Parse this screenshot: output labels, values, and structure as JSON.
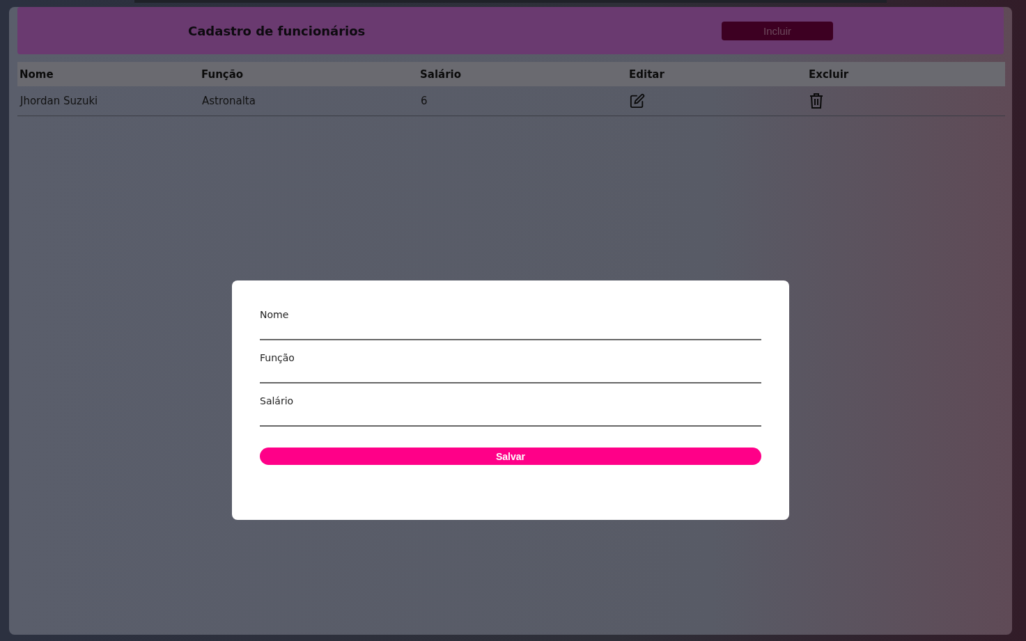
{
  "header": {
    "title": "Cadastro de funcionários",
    "button": "Incluir"
  },
  "table": {
    "columns": [
      "Nome",
      "Função",
      "Salário",
      "Editar",
      "Excluir"
    ],
    "rows": [
      {
        "nome": "Jhordan Suzuki",
        "funcao": "Astronalta",
        "salario": "6"
      }
    ]
  },
  "modal": {
    "fields": [
      {
        "label": "Nome"
      },
      {
        "label": "Função"
      },
      {
        "label": "Salário"
      }
    ],
    "button": "Salvar"
  }
}
